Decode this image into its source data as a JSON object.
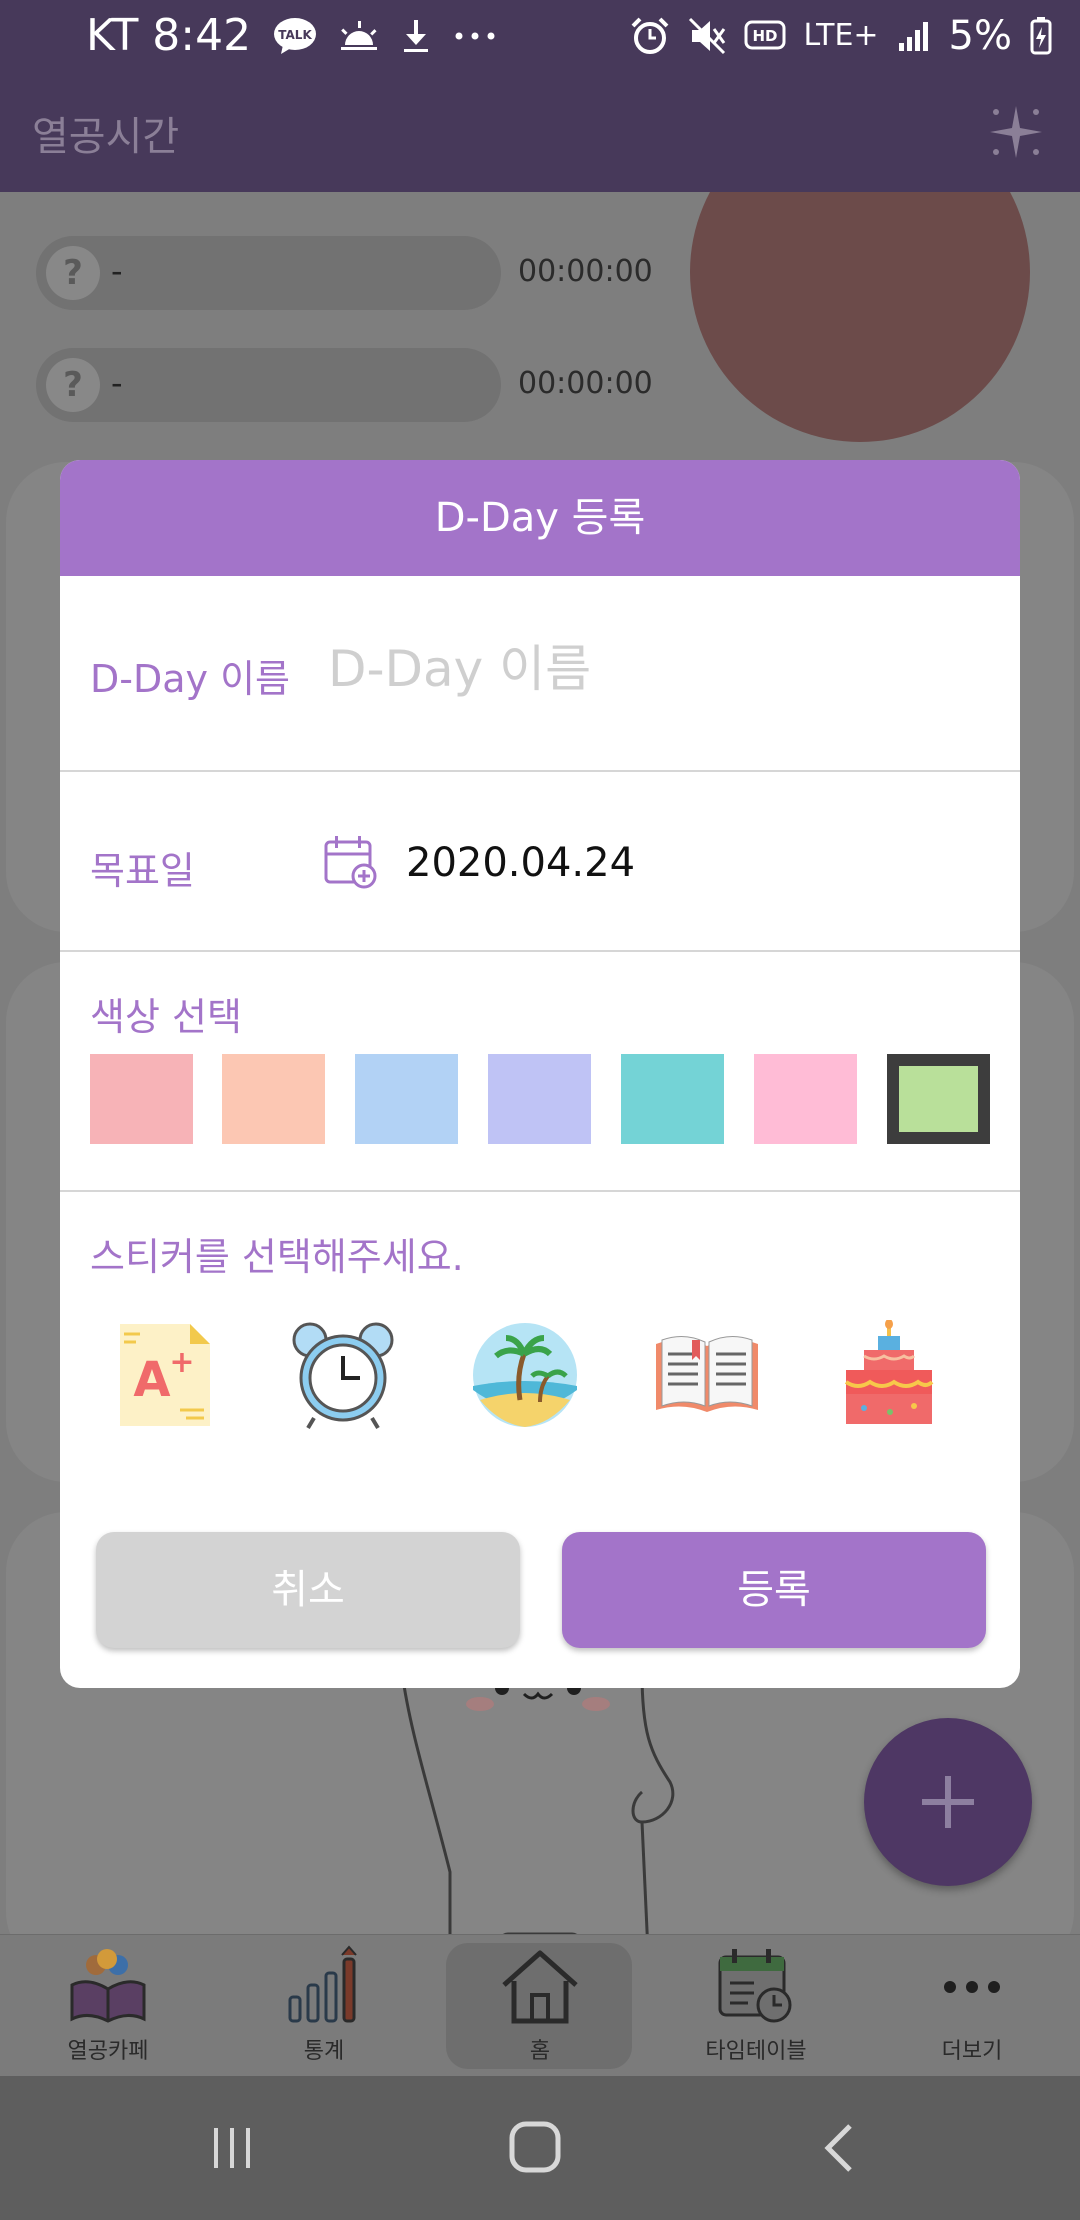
{
  "status_bar": {
    "carrier_time": "KT 8:42",
    "talk_badge": "TALK",
    "network": "LTE+",
    "battery": "5%"
  },
  "app_bar": {
    "title": "열공시간",
    "action_icon": "sparkle-icon"
  },
  "background": {
    "rows": [
      {
        "icon": "?",
        "label": "-",
        "time": "00:00:00"
      },
      {
        "icon": "?",
        "label": "-",
        "time": "00:00:00"
      }
    ]
  },
  "dialog": {
    "title": "D-Day 등록",
    "name_label": "D-Day 이름",
    "name_placeholder": "D-Day 이름",
    "date_label": "목표일",
    "date_value": "2020.04.24",
    "color_label": "색상 선택",
    "colors": [
      "#f7b3b7",
      "#fcc7b3",
      "#b2d2f5",
      "#bfc3f5",
      "#74d3d6",
      "#ffbcd6",
      "#b9e09a"
    ],
    "selected_color_index": 6,
    "sticker_label": "스티커를 선택해주세요.",
    "stickers": [
      "a-plus-paper-icon",
      "alarm-clock-icon",
      "beach-island-icon",
      "open-book-icon",
      "birthday-cake-icon"
    ],
    "cancel_label": "취소",
    "submit_label": "등록"
  },
  "bottom_nav": {
    "items": [
      {
        "label": "열공카페",
        "icon": "study-cafe-icon"
      },
      {
        "label": "통계",
        "icon": "stats-chart-icon"
      },
      {
        "label": "홈",
        "icon": "home-icon",
        "active": true
      },
      {
        "label": "타임테이블",
        "icon": "timetable-icon"
      },
      {
        "label": "더보기",
        "icon": "more-icon"
      }
    ]
  },
  "colors": {
    "accent": "#a374c9",
    "app_bar": "#47395a",
    "scrim": "#7e7e7e"
  }
}
